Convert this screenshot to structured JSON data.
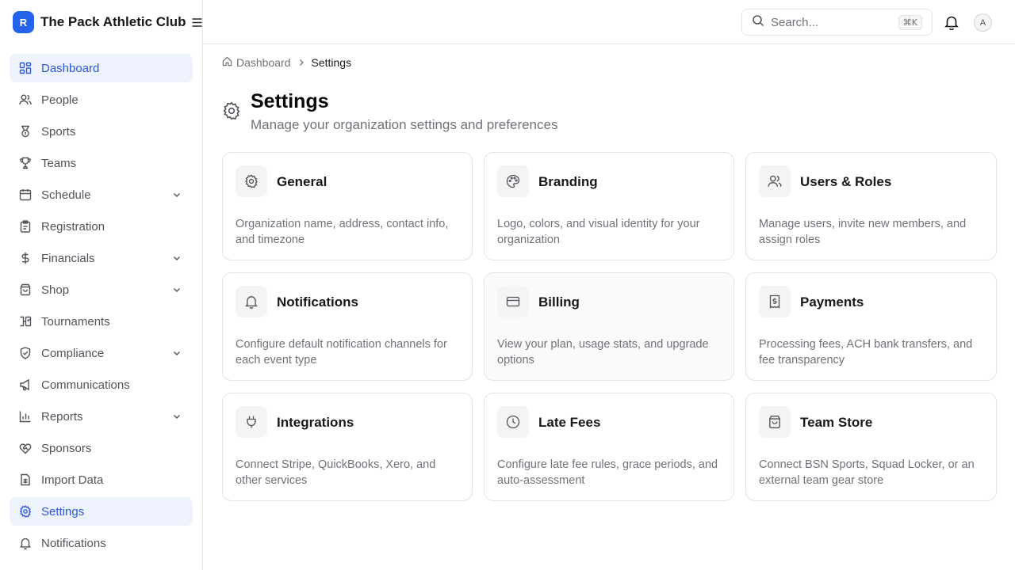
{
  "brand": {
    "initial": "R",
    "name": "The Pack Athletic Club"
  },
  "sidebar": {
    "items": [
      {
        "label": "Dashboard",
        "icon": "dashboard-icon",
        "active": true,
        "chevron": false
      },
      {
        "label": "People",
        "icon": "users-icon",
        "active": false,
        "chevron": false
      },
      {
        "label": "Sports",
        "icon": "medal-icon",
        "active": false,
        "chevron": false
      },
      {
        "label": "Teams",
        "icon": "trophy-icon",
        "active": false,
        "chevron": false
      },
      {
        "label": "Schedule",
        "icon": "calendar-icon",
        "active": false,
        "chevron": true
      },
      {
        "label": "Registration",
        "icon": "clipboard-icon",
        "active": false,
        "chevron": false
      },
      {
        "label": "Financials",
        "icon": "dollar-icon",
        "active": false,
        "chevron": true
      },
      {
        "label": "Shop",
        "icon": "shopping-bag-icon",
        "active": false,
        "chevron": true
      },
      {
        "label": "Tournaments",
        "icon": "bracket-icon",
        "active": false,
        "chevron": false
      },
      {
        "label": "Compliance",
        "icon": "shield-check-icon",
        "active": false,
        "chevron": true
      },
      {
        "label": "Communications",
        "icon": "megaphone-icon",
        "active": false,
        "chevron": false
      },
      {
        "label": "Reports",
        "icon": "bar-chart-icon",
        "active": false,
        "chevron": true
      },
      {
        "label": "Sponsors",
        "icon": "handshake-icon",
        "active": false,
        "chevron": false
      },
      {
        "label": "Import Data",
        "icon": "file-spreadsheet-icon",
        "active": false,
        "chevron": false
      },
      {
        "label": "Settings",
        "icon": "gear-icon",
        "active": true,
        "chevron": false
      },
      {
        "label": "Notifications",
        "icon": "bell-icon",
        "active": false,
        "chevron": false
      }
    ]
  },
  "header": {
    "search_placeholder": "Search...",
    "search_shortcut": "⌘K",
    "avatar_initial": "A"
  },
  "breadcrumb": {
    "home": "Dashboard",
    "current": "Settings"
  },
  "page": {
    "title": "Settings",
    "subtitle": "Manage your organization settings and preferences"
  },
  "cards": [
    {
      "title": "General",
      "desc": "Organization name, address, contact info, and timezone",
      "icon": "gear-icon"
    },
    {
      "title": "Branding",
      "desc": "Logo, colors, and visual identity for your organization",
      "icon": "palette-icon"
    },
    {
      "title": "Users & Roles",
      "desc": "Manage users, invite new members, and assign roles",
      "icon": "users-icon"
    },
    {
      "title": "Notifications",
      "desc": "Configure default notification channels for each event type",
      "icon": "bell-icon"
    },
    {
      "title": "Billing",
      "desc": "View your plan, usage stats, and upgrade options",
      "icon": "credit-card-icon"
    },
    {
      "title": "Payments",
      "desc": "Processing fees, ACH bank transfers, and fee transparency",
      "icon": "receipt-icon"
    },
    {
      "title": "Integrations",
      "desc": "Connect Stripe, QuickBooks, Xero, and other services",
      "icon": "plug-icon"
    },
    {
      "title": "Late Fees",
      "desc": "Configure late fee rules, grace periods, and auto-assessment",
      "icon": "clock-icon"
    },
    {
      "title": "Team Store",
      "desc": "Connect BSN Sports, Squad Locker, or an external team gear store",
      "icon": "shopping-bag-icon"
    }
  ],
  "colors": {
    "accent": "#2563eb",
    "active_bg": "#eef2fd",
    "active_text": "#2c59d9",
    "border": "#e4e4e7",
    "muted_text": "#71717a"
  }
}
